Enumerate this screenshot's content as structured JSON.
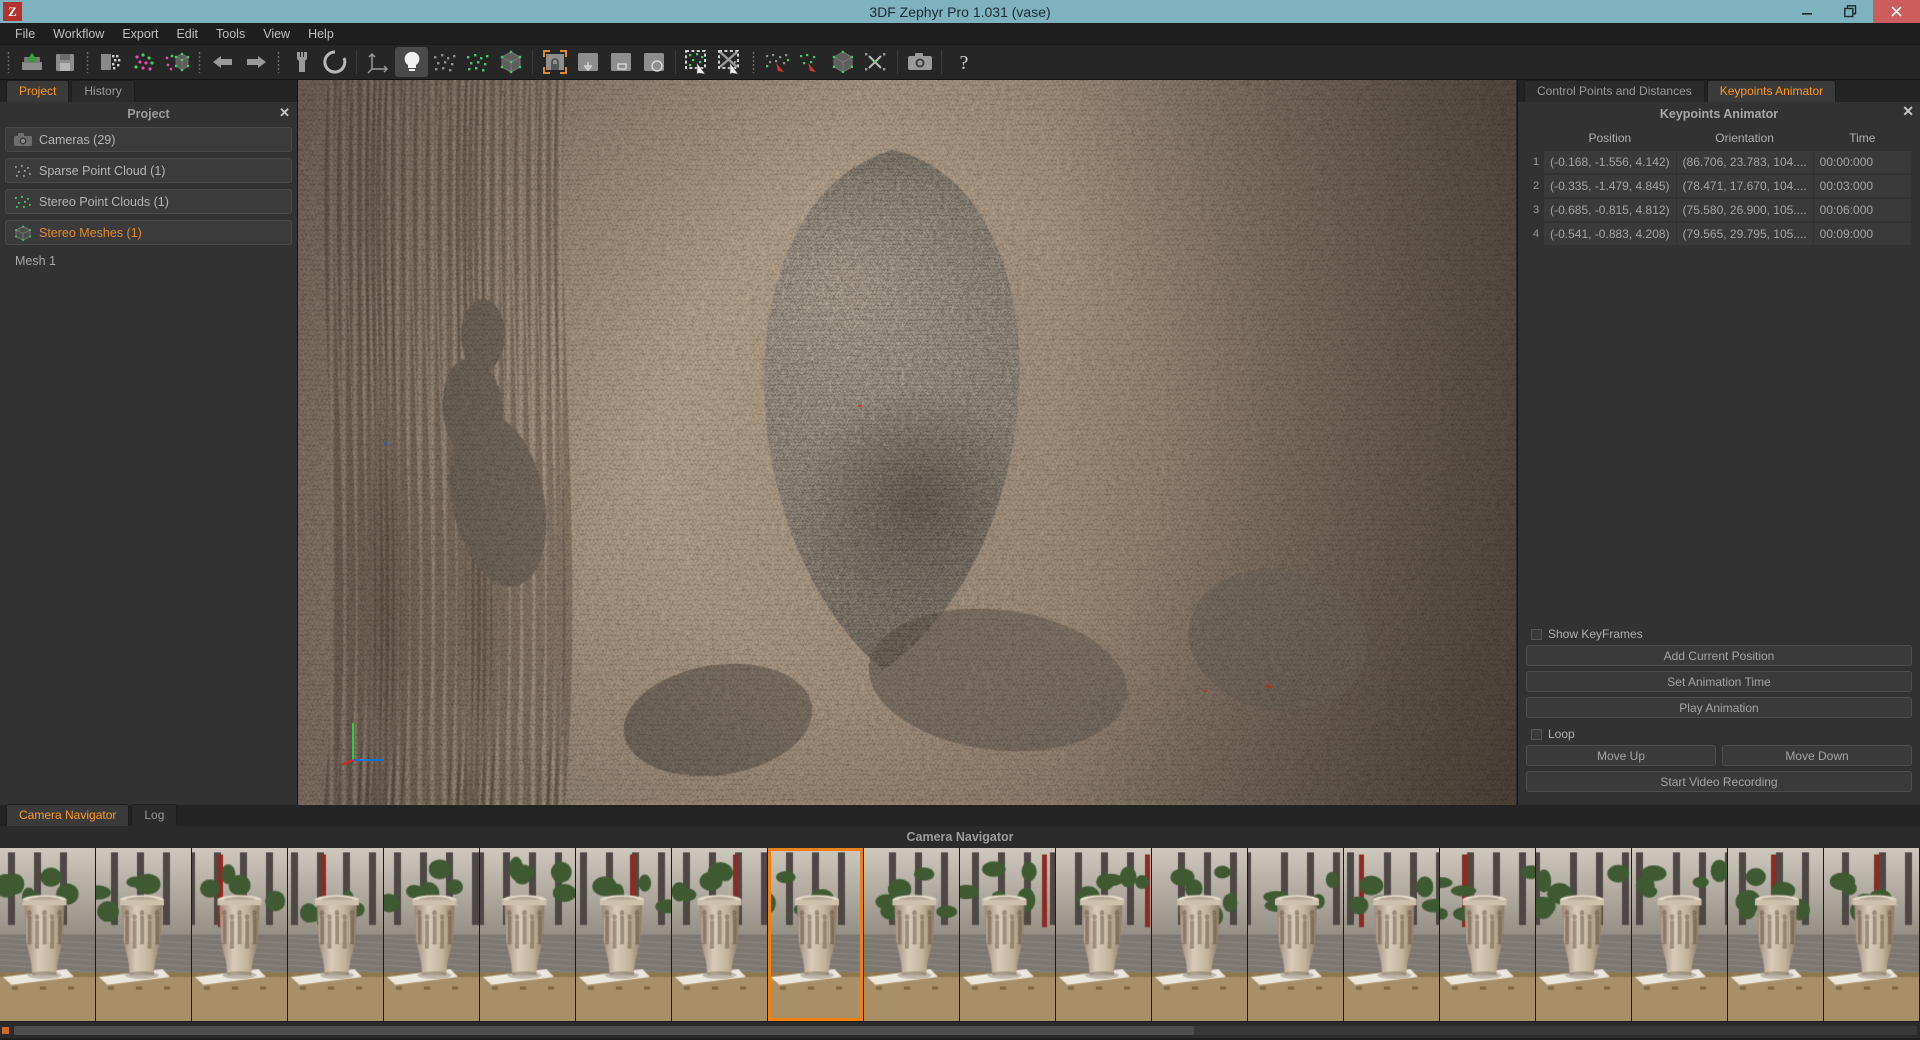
{
  "window": {
    "title": "3DF Zephyr Pro 1.031 (vase)",
    "logo_letter": "Z",
    "minimize_icon": "minimize-icon",
    "maximize_icon": "maximize-icon",
    "close_icon": "close-icon"
  },
  "menubar": {
    "items": [
      {
        "label": "File"
      },
      {
        "label": "Workflow"
      },
      {
        "label": "Export"
      },
      {
        "label": "Edit"
      },
      {
        "label": "Tools"
      },
      {
        "label": "View"
      },
      {
        "label": "Help"
      }
    ]
  },
  "toolbar": {
    "groups": [
      {
        "buttons": [
          {
            "name": "open-project-icon",
            "tip": "Open Project"
          },
          {
            "name": "save-project-icon",
            "tip": "Save Project"
          }
        ]
      },
      {
        "buttons": [
          {
            "name": "import-photos-icon",
            "tip": "Import Photos"
          },
          {
            "name": "sparse-cloud-icon",
            "tip": "Sparse Point Cloud"
          },
          {
            "name": "dense-cloud-icon",
            "tip": "Dense Point Cloud"
          }
        ]
      },
      {
        "buttons": [
          {
            "name": "undo-icon",
            "tip": "Undo"
          },
          {
            "name": "redo-icon",
            "tip": "Redo"
          }
        ]
      },
      {
        "buttons": [
          {
            "name": "wrench-icon",
            "tip": "Settings"
          },
          {
            "name": "reload-icon",
            "tip": "Reset View"
          }
        ]
      },
      {
        "buttons": [
          {
            "name": "axis-icon",
            "tip": "Show Axis"
          },
          {
            "name": "light-bulb-icon",
            "tip": "Lighting",
            "active": true
          },
          {
            "name": "points-grey-icon",
            "tip": "Show Cameras"
          },
          {
            "name": "points-green-icon",
            "tip": "Show Points"
          },
          {
            "name": "bounding-box-icon",
            "tip": "Bounding Box"
          }
        ]
      },
      {
        "buttons": [
          {
            "name": "lock-selection-icon",
            "tip": "Lock Selection",
            "highlight": true
          },
          {
            "name": "select-move-icon",
            "tip": "Move Selection"
          },
          {
            "name": "select-rect-icon",
            "tip": "Rectangle Select"
          },
          {
            "name": "select-lasso-icon",
            "tip": "Lasso Select"
          }
        ]
      },
      {
        "buttons": [
          {
            "name": "select-points-icon",
            "tip": "Select Points"
          },
          {
            "name": "deselect-points-icon",
            "tip": "Deselect Points"
          }
        ]
      },
      {
        "buttons": [
          {
            "name": "filter-points-icon",
            "tip": "Filter Points"
          },
          {
            "name": "delete-points-icon",
            "tip": "Delete Points"
          },
          {
            "name": "mesh-tool-icon",
            "tip": "Mesh Tool"
          },
          {
            "name": "clean-mesh-icon",
            "tip": "Clean Mesh"
          }
        ]
      },
      {
        "buttons": [
          {
            "name": "camera-snapshot-icon",
            "tip": "Take Snapshot"
          }
        ]
      },
      {
        "buttons": [
          {
            "name": "help-icon",
            "tip": "Help"
          }
        ]
      }
    ]
  },
  "left_panel": {
    "tabs": [
      {
        "label": "Project",
        "selected": true
      },
      {
        "label": "History",
        "selected": false
      }
    ],
    "header": "Project",
    "close_icon": "close-icon",
    "tree": [
      {
        "label": "Cameras (29)",
        "icon": "camera-icon",
        "selected": false
      },
      {
        "label": "Sparse Point Cloud (1)",
        "icon": "sparse-points-icon",
        "selected": false
      },
      {
        "label": "Stereo Point Clouds (1)",
        "icon": "dense-points-icon",
        "selected": false
      },
      {
        "label": "Stereo Meshes (1)",
        "icon": "mesh-cube-icon",
        "selected": true
      }
    ],
    "leaf": "Mesh 1"
  },
  "right_panel": {
    "tabs": [
      {
        "label": "Control Points and Distances",
        "selected": false
      },
      {
        "label": "Keypoints Animator",
        "selected": true
      }
    ],
    "header": "Keypoints Animator",
    "close_icon": "close-icon",
    "table": {
      "columns": [
        "Position",
        "Orientation",
        "Time"
      ],
      "rows": [
        {
          "n": "1",
          "position": "(-0.168, -1.556, 4.142)",
          "orientation": "(86.706, 23.783, 104....",
          "time": "00:00:000"
        },
        {
          "n": "2",
          "position": "(-0.335, -1.479, 4.845)",
          "orientation": "(78.471, 17.670, 104....",
          "time": "00:03:000"
        },
        {
          "n": "3",
          "position": "(-0.685, -0.815, 4.812)",
          "orientation": "(75.580, 26.900, 105....",
          "time": "00:06:000"
        },
        {
          "n": "4",
          "position": "(-0.541, -0.883, 4.208)",
          "orientation": "(79.565, 29.795, 105....",
          "time": "00:09:000"
        }
      ]
    },
    "show_keyframes_label": "Show KeyFrames",
    "show_keyframes_checked": false,
    "add_current_position": "Add Current Position",
    "set_animation_time": "Set Animation Time",
    "play_animation": "Play Animation",
    "loop_label": "Loop",
    "loop_checked": false,
    "move_up": "Move Up",
    "move_down": "Move Down",
    "start_video_recording": "Start Video Recording"
  },
  "bottom_dock": {
    "tabs": [
      {
        "label": "Camera Navigator",
        "selected": true
      },
      {
        "label": "Log",
        "selected": false
      }
    ],
    "title": "Camera Navigator",
    "thumbnail_count": 20,
    "selected_thumbnail_index": 8
  },
  "colors": {
    "accent_orange": "#ff9a1e",
    "selection_orange": "#f08010",
    "titlebar_blue": "#7fb2bf",
    "close_red": "#cd5c5c",
    "panel_bg": "#323232",
    "toolbar_bg": "#262626"
  }
}
